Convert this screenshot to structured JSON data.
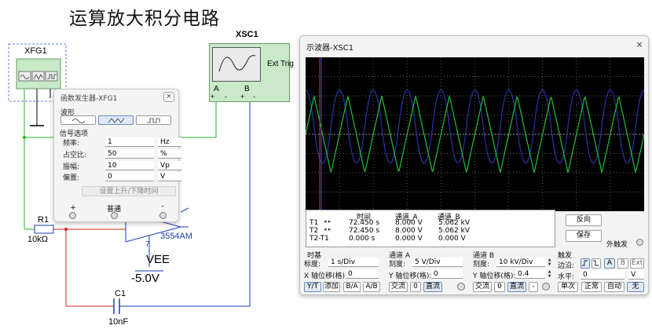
{
  "schematic": {
    "title": "运算放大积分电路",
    "xfg_label": "XFG1",
    "xsc_label": "XSC1",
    "ext_trig": "Ext Trig",
    "xsc_a": "A",
    "xsc_b": "B",
    "xsc_plus": "+",
    "xsc_minus": "-",
    "r1": "R1",
    "r1_value": "10kΩ",
    "opamp": "3554AM",
    "pin7": "7",
    "vee": "VEE",
    "vee_value": "-5.0V",
    "c1": "C1",
    "c1_value": "10nF"
  },
  "function_generator": {
    "title": "函数发生器-XFG1",
    "close": "×",
    "waveform_label": "波形",
    "signal_label": "信号选项",
    "rows": [
      {
        "key": "频率:",
        "value": "1",
        "unit": "Hz"
      },
      {
        "key": "占空比:",
        "value": "50",
        "unit": "%"
      },
      {
        "key": "振幅:",
        "value": "10",
        "unit": "Vp"
      },
      {
        "key": "偏置:",
        "value": "0",
        "unit": "V"
      }
    ],
    "set_button": "设置上升/下降时间",
    "term_plus": "+",
    "term_common": "普通",
    "term_minus": "-"
  },
  "oscilloscope": {
    "title": "示波器-XSC1",
    "close": "×",
    "meas": {
      "headers": [
        "时间",
        "通道_A",
        "通道_B"
      ],
      "rows": [
        {
          "label": "T1",
          "time": "72.450 s",
          "a": "8.000 V",
          "b": "5.062 kV"
        },
        {
          "label": "T2",
          "time": "72.450 s",
          "a": "8.000 V",
          "b": "5.062 kV"
        },
        {
          "label": "T2-T1",
          "time": "0.000 s",
          "a": "0.000 V",
          "b": "0.000 V"
        }
      ]
    },
    "reverse_button": "反向",
    "save_button": "保存",
    "ext_trigger": "外触发",
    "timebase": {
      "title": "时基",
      "scale_label": "标度:",
      "scale_value": "1  s/Div",
      "xpos_label": "X 轴位移(格):",
      "xpos_value": "0",
      "yt": "Y/T",
      "add": "添加",
      "ba": "B/A",
      "ab": "A/B"
    },
    "channel_a": {
      "title": "通道 A",
      "scale_label": "刻度:",
      "scale_value": "5  V/Div",
      "ypos_label": "Y 轴位移(格):",
      "ypos_value": "0",
      "ac": "交流",
      "zero": "0",
      "dc": "直流"
    },
    "channel_b": {
      "title": "通道 B",
      "scale_label": "刻度:",
      "scale_value": "10  kV/Div",
      "ypos_label": "Y 轴位移(格):",
      "ypos_value": "0.4",
      "ac": "交流",
      "zero": "0",
      "dc": "直流",
      "minus": "-"
    },
    "trigger": {
      "title": "触发",
      "edge_label": "边沿:",
      "a": "A",
      "b": "B",
      "ext": "Ext",
      "level_label": "水平:",
      "level_value": "0",
      "level_unit": "V",
      "single": "单次",
      "normal": "正常",
      "auto": "自动",
      "none": "无"
    }
  },
  "colors": {
    "trace_a": "#1fc13a",
    "trace_b": "#2a33a8",
    "wire_red": "#d42020",
    "wire_green": "#2bb52b",
    "wire_blue": "#1a3fb0",
    "scope_bg": "#000000",
    "accent": "#2b5fb4"
  }
}
